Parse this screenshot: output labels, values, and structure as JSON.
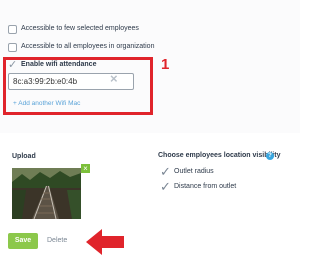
{
  "access_options": [
    {
      "label": "Accessible to few selected employees",
      "checked": false
    },
    {
      "label": "Accessible to all employees in organization",
      "checked": false
    }
  ],
  "wifi_attendance": {
    "label": "Enable wifi attendance",
    "checked": true,
    "mac_value": "8c:a3:99:2b:e0:4b",
    "add_link": "+ Add another Wifi Mac",
    "annotation_number": "1"
  },
  "upload": {
    "label": "Upload",
    "remove_symbol": "×"
  },
  "visibility": {
    "title": "Choose employees location visibility",
    "help_symbol": "?",
    "options": [
      {
        "label": "Outlet radius",
        "checked": true
      },
      {
        "label": "Distance from outlet",
        "checked": true
      }
    ]
  },
  "actions": {
    "save_label": "Save",
    "delete_label": "Delete"
  },
  "colors": {
    "annotation": "#e0242b",
    "save_button": "#8cc84b",
    "link": "#5aa3d8",
    "help_icon": "#3aa7e0"
  }
}
